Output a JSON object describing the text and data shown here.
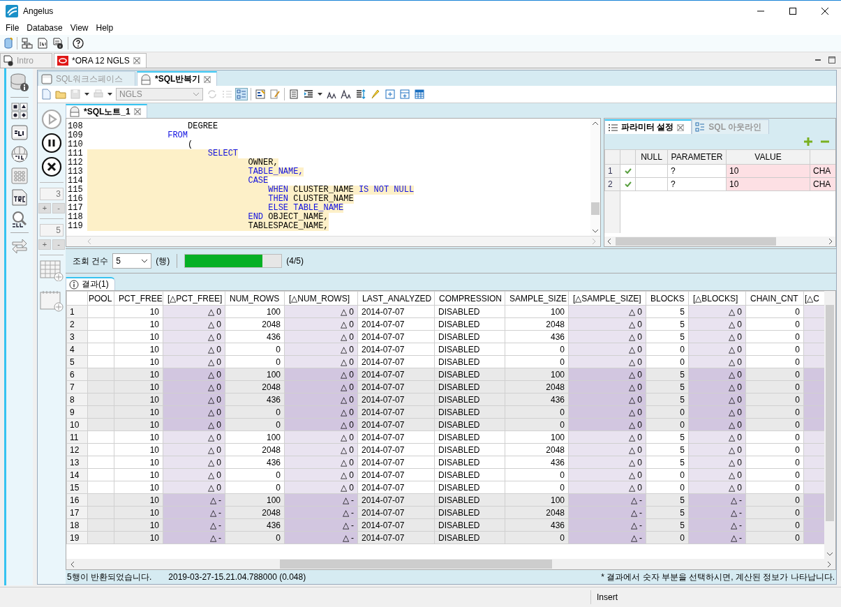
{
  "window": {
    "title": "Angelus"
  },
  "menu": [
    "File",
    "Database",
    "View",
    "Help"
  ],
  "doc_tabs": [
    {
      "label": "Intro",
      "selected": false,
      "disabled": true,
      "closable": false,
      "kind": "intro"
    },
    {
      "label": "*ORA 12 NGLS",
      "selected": true,
      "disabled": false,
      "closable": true,
      "kind": "oracle"
    }
  ],
  "sub_tabs": [
    {
      "label": "SQL워크스페이스",
      "selected": false,
      "closable": false
    },
    {
      "label": "*SQL반복기",
      "selected": true,
      "closable": true
    }
  ],
  "connection": {
    "value": "NGLS",
    "disabled": true
  },
  "run_controls": [
    {
      "kind": "play",
      "disabled": true
    },
    {
      "kind": "pause",
      "disabled": false
    },
    {
      "kind": "stop",
      "disabled": false
    }
  ],
  "spinners": [
    {
      "value": "3",
      "disabled": true,
      "plus": "+",
      "minus": "-"
    },
    {
      "value": "5",
      "disabled": true,
      "plus": "+",
      "minus": "-"
    }
  ],
  "editor": {
    "tab": "*SQL노트_1",
    "lines": [
      {
        "number": "108",
        "highlighted": false,
        "segments": [
          {
            "text": "                    DEGREE",
            "kind": "ident"
          }
        ]
      },
      {
        "number": "109",
        "highlighted": false,
        "segments": [
          {
            "text": "                FROM",
            "kind": "keyword"
          }
        ]
      },
      {
        "number": "110",
        "highlighted": false,
        "segments": [
          {
            "text": "                    (",
            "kind": "ident"
          }
        ]
      },
      {
        "number": "111",
        "highlighted": true,
        "segments": [
          {
            "text": "                        SELECT",
            "kind": "keyword"
          }
        ]
      },
      {
        "number": "112",
        "highlighted": true,
        "segments": [
          {
            "text": "                                OWNER,",
            "kind": "ident"
          }
        ]
      },
      {
        "number": "113",
        "highlighted": true,
        "segments": [
          {
            "text": "                                TABLE_NAME,",
            "kind": "keyword"
          }
        ]
      },
      {
        "number": "114",
        "highlighted": true,
        "segments": [
          {
            "text": "                                CASE",
            "kind": "keyword"
          }
        ]
      },
      {
        "number": "115",
        "highlighted": true,
        "segments": [
          {
            "text": "                                    WHEN",
            "kind": "keyword"
          },
          {
            "text": " CLUSTER_NAME ",
            "kind": "ident"
          },
          {
            "text": "IS NOT NULL",
            "kind": "keyword"
          }
        ]
      },
      {
        "number": "116",
        "highlighted": true,
        "segments": [
          {
            "text": "                                    THEN",
            "kind": "keyword"
          },
          {
            "text": " CLUSTER_NAME",
            "kind": "ident"
          }
        ]
      },
      {
        "number": "117",
        "highlighted": true,
        "segments": [
          {
            "text": "                                    ELSE TABLE_NAME",
            "kind": "keyword"
          }
        ]
      },
      {
        "number": "118",
        "highlighted": true,
        "segments": [
          {
            "text": "                                END",
            "kind": "keyword"
          },
          {
            "text": " OBJECT_NAME,",
            "kind": "ident"
          }
        ]
      },
      {
        "number": "119",
        "highlighted": true,
        "segments": [
          {
            "text": "                                TABLESPACE_NAME,",
            "kind": "ident"
          }
        ]
      }
    ]
  },
  "params": {
    "tabs": [
      {
        "label": "파라미터 설정",
        "selected": true,
        "closable": true
      },
      {
        "label": "SQL 아웃라인",
        "selected": false,
        "closable": false
      }
    ],
    "columns": [
      "NULL",
      "PARAMETER",
      "VALUE"
    ],
    "rows": [
      {
        "number": "1",
        "valid": true,
        "parameter": "?",
        "value": "10",
        "type": "CHA"
      },
      {
        "number": "2",
        "valid": true,
        "parameter": "?",
        "value": "10",
        "type": "CHA"
      }
    ]
  },
  "fetch": {
    "label": "조회 건수",
    "count": "5",
    "unit": "(행)",
    "level": 0.8,
    "progress": "(4/5)"
  },
  "results": {
    "tab": "결과(1)",
    "columns": [
      {
        "label": "POOL",
        "kind": "text"
      },
      {
        "label": "PCT_FREE",
        "kind": "number"
      },
      {
        "label": "[△PCT_FREE]",
        "kind": "delta"
      },
      {
        "label": "NUM_ROWS",
        "kind": "number"
      },
      {
        "label": "[△NUM_ROWS]",
        "kind": "delta"
      },
      {
        "label": "LAST_ANALYZED",
        "kind": "text"
      },
      {
        "label": "COMPRESSION",
        "kind": "text"
      },
      {
        "label": "SAMPLE_SIZE",
        "kind": "number"
      },
      {
        "label": "[△SAMPLE_SIZE]",
        "kind": "delta"
      },
      {
        "label": "BLOCKS",
        "kind": "number"
      },
      {
        "label": "[△BLOCKS]",
        "kind": "delta"
      },
      {
        "label": "CHAIN_CNT",
        "kind": "number"
      },
      {
        "label": "[△C",
        "kind": "delta"
      }
    ],
    "rows": [
      {
        "number": "1",
        "shaded": false,
        "cells": [
          "",
          "10",
          "△ 0",
          "100",
          "△ 0",
          "2014-07-07",
          "DISABLED",
          "100",
          "△ 0",
          "5",
          "△ 0",
          "0",
          ""
        ]
      },
      {
        "number": "2",
        "shaded": false,
        "cells": [
          "",
          "10",
          "△ 0",
          "2048",
          "△ 0",
          "2014-07-07",
          "DISABLED",
          "2048",
          "△ 0",
          "5",
          "△ 0",
          "0",
          ""
        ]
      },
      {
        "number": "3",
        "shaded": false,
        "cells": [
          "",
          "10",
          "△ 0",
          "436",
          "△ 0",
          "2014-07-07",
          "DISABLED",
          "436",
          "△ 0",
          "5",
          "△ 0",
          "0",
          ""
        ]
      },
      {
        "number": "4",
        "shaded": false,
        "cells": [
          "",
          "10",
          "△ 0",
          "0",
          "△ 0",
          "2014-07-07",
          "DISABLED",
          "0",
          "△ 0",
          "0",
          "△ 0",
          "0",
          ""
        ]
      },
      {
        "number": "5",
        "shaded": false,
        "cells": [
          "",
          "10",
          "△ 0",
          "0",
          "△ 0",
          "2014-07-07",
          "DISABLED",
          "0",
          "△ 0",
          "0",
          "△ 0",
          "0",
          ""
        ]
      },
      {
        "number": "6",
        "shaded": true,
        "cells": [
          "",
          "10",
          "△ 0",
          "100",
          "△ 0",
          "2014-07-07",
          "DISABLED",
          "100",
          "△ 0",
          "5",
          "△ 0",
          "0",
          ""
        ]
      },
      {
        "number": "7",
        "shaded": true,
        "cells": [
          "",
          "10",
          "△ 0",
          "2048",
          "△ 0",
          "2014-07-07",
          "DISABLED",
          "2048",
          "△ 0",
          "5",
          "△ 0",
          "0",
          ""
        ]
      },
      {
        "number": "8",
        "shaded": true,
        "cells": [
          "",
          "10",
          "△ 0",
          "436",
          "△ 0",
          "2014-07-07",
          "DISABLED",
          "436",
          "△ 0",
          "5",
          "△ 0",
          "0",
          ""
        ]
      },
      {
        "number": "9",
        "shaded": true,
        "cells": [
          "",
          "10",
          "△ 0",
          "0",
          "△ 0",
          "2014-07-07",
          "DISABLED",
          "0",
          "△ 0",
          "0",
          "△ 0",
          "0",
          ""
        ]
      },
      {
        "number": "10",
        "shaded": true,
        "cells": [
          "",
          "10",
          "△ 0",
          "0",
          "△ 0",
          "2014-07-07",
          "DISABLED",
          "0",
          "△ 0",
          "0",
          "△ 0",
          "0",
          ""
        ]
      },
      {
        "number": "11",
        "shaded": false,
        "cells": [
          "",
          "10",
          "△ 0",
          "100",
          "△ 0",
          "2014-07-07",
          "DISABLED",
          "100",
          "△ 0",
          "5",
          "△ 0",
          "0",
          ""
        ]
      },
      {
        "number": "12",
        "shaded": false,
        "cells": [
          "",
          "10",
          "△ 0",
          "2048",
          "△ 0",
          "2014-07-07",
          "DISABLED",
          "2048",
          "△ 0",
          "5",
          "△ 0",
          "0",
          ""
        ]
      },
      {
        "number": "13",
        "shaded": false,
        "cells": [
          "",
          "10",
          "△ 0",
          "436",
          "△ 0",
          "2014-07-07",
          "DISABLED",
          "436",
          "△ 0",
          "5",
          "△ 0",
          "0",
          ""
        ]
      },
      {
        "number": "14",
        "shaded": false,
        "cells": [
          "",
          "10",
          "△ 0",
          "0",
          "△ 0",
          "2014-07-07",
          "DISABLED",
          "0",
          "△ 0",
          "0",
          "△ 0",
          "0",
          ""
        ]
      },
      {
        "number": "15",
        "shaded": false,
        "cells": [
          "",
          "10",
          "△ 0",
          "0",
          "△ 0",
          "2014-07-07",
          "DISABLED",
          "0",
          "△ 0",
          "0",
          "△ 0",
          "0",
          ""
        ]
      },
      {
        "number": "16",
        "shaded": true,
        "cells": [
          "",
          "10",
          "△ -",
          "100",
          "△ -",
          "2014-07-07",
          "DISABLED",
          "100",
          "△ -",
          "5",
          "△ -",
          "0",
          ""
        ]
      },
      {
        "number": "17",
        "shaded": true,
        "cells": [
          "",
          "10",
          "△ -",
          "2048",
          "△ -",
          "2014-07-07",
          "DISABLED",
          "2048",
          "△ -",
          "5",
          "△ -",
          "0",
          ""
        ]
      },
      {
        "number": "18",
        "shaded": true,
        "cells": [
          "",
          "10",
          "△ -",
          "436",
          "△ -",
          "2014-07-07",
          "DISABLED",
          "436",
          "△ -",
          "5",
          "△ -",
          "0",
          ""
        ]
      },
      {
        "number": "19",
        "shaded": true,
        "cells": [
          "",
          "10",
          "△ -",
          "0",
          "△ -",
          "2014-07-07",
          "DISABLED",
          "0",
          "△ -",
          "0",
          "△ -",
          "0",
          ""
        ]
      }
    ],
    "status": "5행이 반환되었습니다.",
    "timestamp": "2019-03-27-15.21.04.788000 (0.048)",
    "hint": "* 결과에서 숫자 부분을 선택하시면, 계산된 정보가 나타납니다."
  },
  "status_bar": {
    "mode": "Insert"
  }
}
